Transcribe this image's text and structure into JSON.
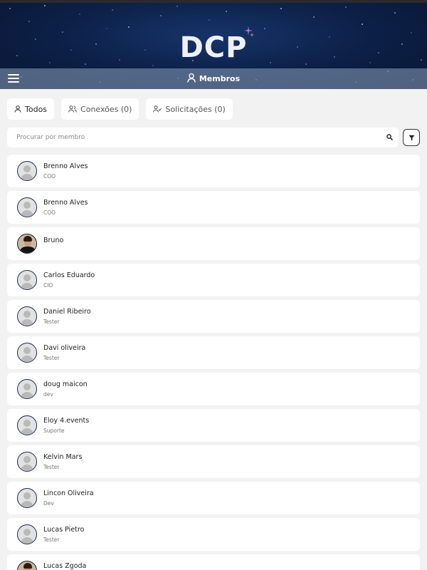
{
  "brand": {
    "logo_text": "DCP"
  },
  "navbar": {
    "title": "Membros"
  },
  "tabs": [
    {
      "label": "Todos",
      "icon": "user-icon"
    },
    {
      "label": "Conexões (0)",
      "icon": "users-icon"
    },
    {
      "label": "Solicitações (0)",
      "icon": "user-check-icon"
    }
  ],
  "search": {
    "placeholder": "Procurar por membro",
    "value": ""
  },
  "members": [
    {
      "name": "Brenno Alves",
      "role": "COO"
    },
    {
      "name": "Brenno Alves",
      "role": "COO"
    },
    {
      "name": "Bruno",
      "role": ""
    },
    {
      "name": "Carlos Eduardo",
      "role": "CIO"
    },
    {
      "name": "Daniel Ribeiro",
      "role": "Tester"
    },
    {
      "name": "Davi oliveira",
      "role": "Tester"
    },
    {
      "name": "doug maicon",
      "role": "dev"
    },
    {
      "name": "Eloy 4.events",
      "role": "Suporte"
    },
    {
      "name": "Kelvin Mars",
      "role": "Tester"
    },
    {
      "name": "Lincon Oliveira",
      "role": "Dev"
    },
    {
      "name": "Lucas Pietro",
      "role": "Tester"
    },
    {
      "name": "Lucas Zgoda",
      "role": ""
    }
  ],
  "colors": {
    "banner": "#0c1f45",
    "avatar_border": "#1d2a55",
    "background": "#f2f2f2"
  }
}
